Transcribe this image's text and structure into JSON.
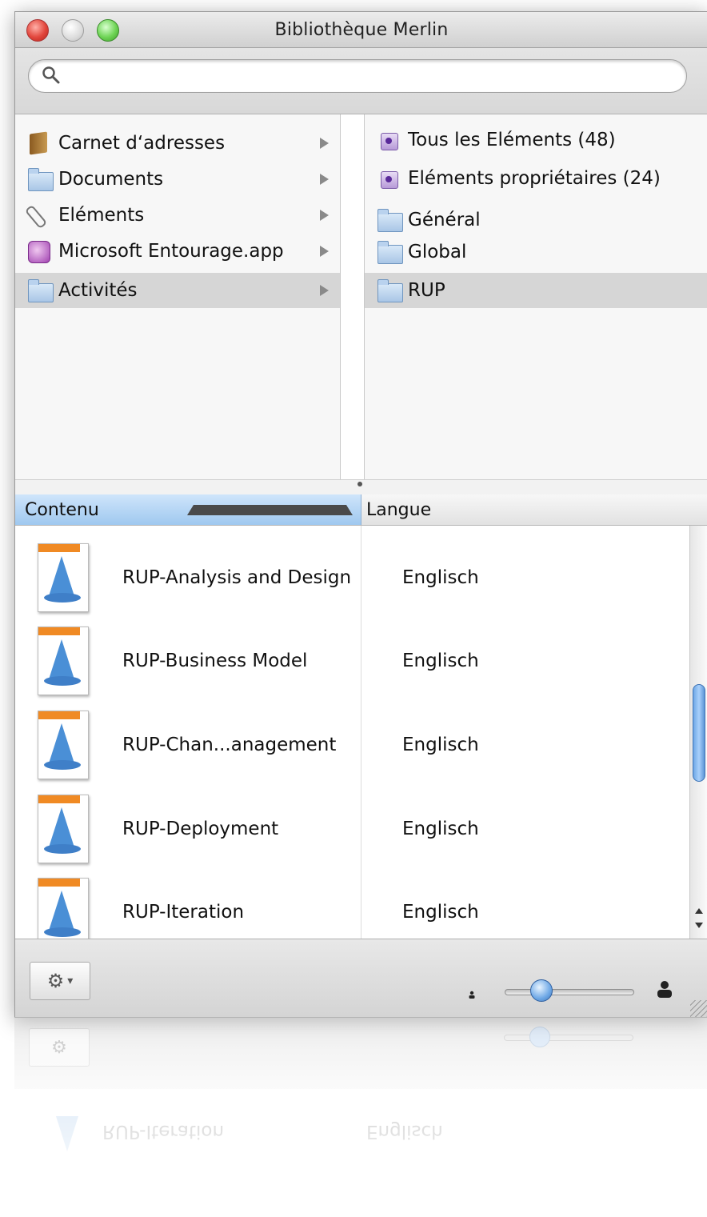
{
  "window": {
    "title": "Bibliothèque Merlin"
  },
  "search": {
    "value": "",
    "placeholder": ""
  },
  "sources": [
    {
      "label": "Carnet d‘adresses",
      "icon": "address-book-icon"
    },
    {
      "label": "Documents",
      "icon": "folder-icon"
    },
    {
      "label": "Eléments",
      "icon": "paperclip-icon"
    },
    {
      "label": "Microsoft Entourage.app",
      "icon": "entourage-app-icon"
    },
    {
      "label": "Activités",
      "icon": "folder-icon",
      "selected": true
    }
  ],
  "groups": [
    {
      "label": "Tous les Eléments (48)",
      "icon": "smart-group-icon"
    },
    {
      "label": "Eléments propriétaires (24)",
      "icon": "smart-group-icon"
    },
    {
      "label": "Général",
      "icon": "folder-icon"
    },
    {
      "label": "Global",
      "icon": "folder-icon"
    },
    {
      "label": "RUP",
      "icon": "folder-icon",
      "selected": true
    }
  ],
  "table": {
    "columns": {
      "content": "Contenu",
      "language": "Langue"
    },
    "sort": "ascending",
    "rows": [
      {
        "name": "RUP-Analysis and Design",
        "language": "Englisch"
      },
      {
        "name": "RUP-Business Model",
        "language": "Englisch"
      },
      {
        "name": "RUP-Chan...anagement",
        "language": "Englisch"
      },
      {
        "name": "RUP-Deployment",
        "language": "Englisch"
      },
      {
        "name": "RUP-Iteration",
        "language": "Englisch"
      }
    ]
  },
  "reflection": {
    "name": "RUP-Iteration",
    "language": "Englisch"
  },
  "colors": {
    "selection": "#d6d6d6",
    "header_selected": "#9fc8ef",
    "accent": "#4a8fd6"
  }
}
